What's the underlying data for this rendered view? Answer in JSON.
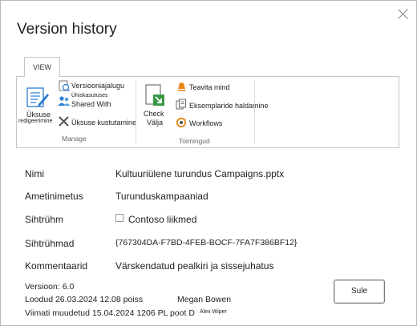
{
  "dialog": {
    "title": "Version history"
  },
  "ribbon": {
    "tab": "VIEW",
    "manage": {
      "group_label": "Manage",
      "edit_item_line1": "Üksuse",
      "edit_item_line2": "redigeerimine",
      "version_history": "Versiooniajalugu",
      "shared_with_line1": "Ühiskasutuses",
      "shared_with_line2": "Shared With",
      "delete_item": "Üksuse kustutamine"
    },
    "actions": {
      "group_label": "Toimingud",
      "check_out_line1": "Check",
      "check_out_line2": "Välja",
      "alert_me": "Teavita mind",
      "manage_copies": "Eksemplaride haldamine",
      "workflows": "Workflows"
    }
  },
  "fields": [
    {
      "label": "Nimi",
      "value": "Kultuuriülene turundus Campaigns.pptx"
    },
    {
      "label": "Ametinimetus",
      "value": "Turunduskampaaniad"
    },
    {
      "label": "Sihtrühm",
      "value": "Contoso liikmed"
    },
    {
      "label": "Sihtrühmad",
      "value": "{767304DA-F7BD-4FEB-BOCF-7FA7F386BF12}"
    },
    {
      "label": "Kommentaarid",
      "value": "Värskendatud pealkiri ja sissejuhatus"
    }
  ],
  "footer": {
    "version": "Versioon: 6.0",
    "created": "Loodud 26.03.2024 12.08 poiss",
    "created_by": "Megan Bowen",
    "modified": "Viimati muudetud 15.04.2024 1206 PL poot D",
    "modified_by": "Alex Wiper",
    "close_button": "Sule"
  },
  "colors": {
    "accent_blue": "#2b7cd3",
    "accent_orange": "#e8891a",
    "green": "#3a9a46"
  }
}
